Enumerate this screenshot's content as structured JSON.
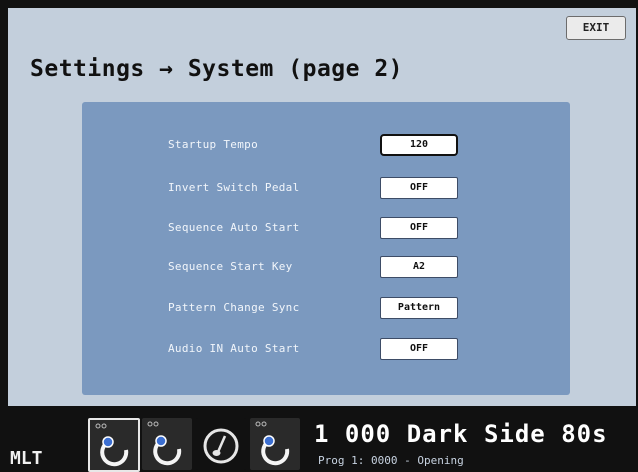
{
  "header": {
    "exit_label": "EXIT",
    "title": "Settings → System (page 2)"
  },
  "settings": [
    {
      "label": "Startup Tempo",
      "value": "120",
      "selected": true
    },
    {
      "label": "Invert Switch Pedal",
      "value": "OFF"
    },
    {
      "label": "Sequence Auto Start",
      "value": "OFF"
    },
    {
      "label": "Sequence Start Key",
      "value": "A2"
    },
    {
      "label": "Pattern Change Sync",
      "value": "Pattern"
    },
    {
      "label": "Audio IN Auto Start",
      "value": "OFF"
    }
  ],
  "footer": {
    "mode_label": "MLT",
    "slot_icons": [
      "loop-knob-icon",
      "loop-knob-icon",
      "metronome-icon",
      "loop-knob-icon"
    ],
    "preset_name": "1 000 Dark Side 80s",
    "preset_sub": "Prog 1: 0000 - Opening"
  },
  "colors": {
    "screen_bg": "#c3cfdc",
    "panel_bg": "#7b99bf",
    "footer_bg": "#111111"
  }
}
